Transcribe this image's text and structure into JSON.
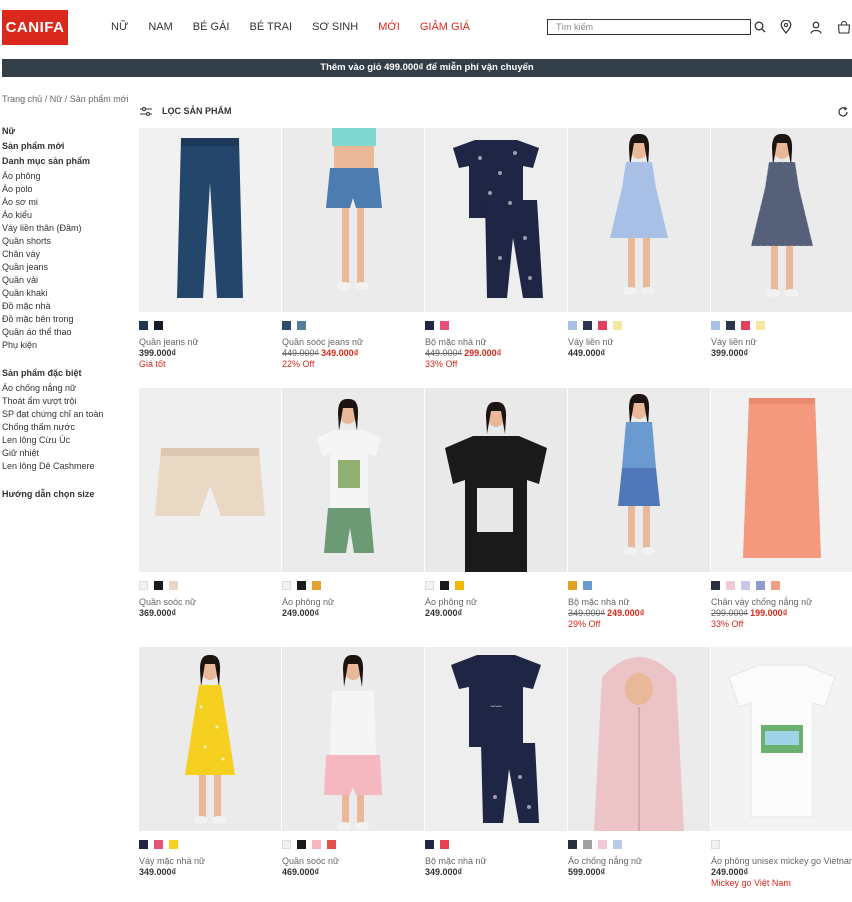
{
  "header": {
    "logo": "CANIFA",
    "nav": [
      {
        "label": "NỮ",
        "red": false
      },
      {
        "label": "NAM",
        "red": false
      },
      {
        "label": "BÉ GÁI",
        "red": false
      },
      {
        "label": "BÉ TRAI",
        "red": false
      },
      {
        "label": "SƠ SINH",
        "red": false
      },
      {
        "label": "MỚI",
        "red": true
      },
      {
        "label": "GIẢM GIÁ",
        "red": true
      }
    ],
    "search_placeholder": "Tìm kiếm"
  },
  "banner": "Thêm vào giỏ 499.000₫ để miễn phí vận chuyển",
  "breadcrumb": "Trang chủ / Nữ / Sản phẩm mới",
  "sidebar": {
    "title": "Nữ",
    "new": "Sản phẩm mới",
    "categories_title": "Danh mục sản phẩm",
    "categories": [
      "Áo phông",
      "Áo polo",
      "Áo sơ mi",
      "Áo kiểu",
      "Váy liền thân (Đầm)",
      "Quần shorts",
      "Chân váy",
      "Quần jeans",
      "Quần vải",
      "Quần khaki",
      "Đồ mặc nhà",
      "Đồ mặc bên trong",
      "Quần áo thể thao",
      "Phụ kiện"
    ],
    "special_title": "Sản phẩm đặc biệt",
    "special": [
      "Áo chống nắng nữ",
      "Thoát ẩm vượt trội",
      "SP đạt chứng chỉ an toàn",
      "Chống thấm nước",
      "Len lông Cừu Úc",
      "Giữ nhiệt",
      "Len lông Dê Cashmere"
    ],
    "guide": "Hướng dẫn chọn size"
  },
  "filter_label": "LỌC SẢN PHẨM",
  "products": [
    {
      "name": "Quần jeans nữ",
      "old": "",
      "price": "399.000₫",
      "sale": false,
      "tag": "Giá tốt",
      "swatches": [
        "#1f3552",
        "#161c26"
      ],
      "kind": "jeans",
      "bg": "#f1f1f1"
    },
    {
      "name": "Quần soóc jeans nữ",
      "old": "449.000₫",
      "price": "349.000₫",
      "sale": true,
      "tag": "22% Off",
      "swatches": [
        "#2d4d6b",
        "#4f7f99"
      ],
      "kind": "person-shorts",
      "bg": "#ebebeb"
    },
    {
      "name": "Bộ mặc nhà nữ",
      "old": "449.000₫",
      "price": "299.000₫",
      "sale": true,
      "tag": "33% Off",
      "swatches": [
        "#1f2544",
        "#e8507a"
      ],
      "kind": "pajama",
      "bg": "#eeeeee"
    },
    {
      "name": "Váy liền nữ",
      "old": "",
      "price": "449.000₫",
      "sale": false,
      "tag": "",
      "swatches": [
        "#a8c0e6",
        "#2a3550",
        "#e0405a",
        "#f5e6a0"
      ],
      "kind": "dress-blue",
      "bg": "#ebebeb"
    },
    {
      "name": "Váy liền nữ",
      "old": "",
      "price": "399.000₫",
      "sale": false,
      "tag": "",
      "swatches": [
        "#a8c0e6",
        "#2a3550",
        "#e0405a",
        "#f5e6a0"
      ],
      "kind": "dress-check",
      "bg": "#ebebeb"
    },
    {
      "name": "Quần soóc nữ",
      "old": "",
      "price": "369.000₫",
      "sale": false,
      "tag": "",
      "swatches": [
        "#f2f2f2",
        "#1a1a1a",
        "#e8d8c4"
      ],
      "kind": "shorts-beige",
      "bg": "#efefef"
    },
    {
      "name": "Áo phông nữ",
      "old": "",
      "price": "249.000₫",
      "sale": false,
      "tag": "",
      "swatches": [
        "#f2f2f2",
        "#1a1a1a",
        "#e8a030"
      ],
      "kind": "person-tee",
      "bg": "#ebebeb"
    },
    {
      "name": "Áo phông nữ",
      "old": "",
      "price": "249.000₫",
      "sale": false,
      "tag": "",
      "swatches": [
        "#f2f2f2",
        "#1a1a1a",
        "#f0b800"
      ],
      "kind": "person-black",
      "bg": "#e9e9e9"
    },
    {
      "name": "Bộ mặc nhà nữ",
      "old": "349.000₫",
      "price": "249.000₫",
      "sale": true,
      "tag": "29% Off",
      "swatches": [
        "#e0a020",
        "#6a9ad0"
      ],
      "kind": "person-floral",
      "bg": "#ebebeb"
    },
    {
      "name": "Chân váy chống nắng nữ",
      "old": "299.000₫",
      "price": "199.000₫",
      "sale": true,
      "tag": "33% Off",
      "swatches": [
        "#2a3040",
        "#f2c8d8",
        "#c8c8e8",
        "#8f9ad0",
        "#f0a080"
      ],
      "kind": "skirt",
      "bg": "#f1f1f1"
    },
    {
      "name": "Váy mặc nhà nữ",
      "old": "",
      "price": "349.000₫",
      "sale": false,
      "tag": "",
      "swatches": [
        "#1f2544",
        "#e8507a",
        "#f5d020"
      ],
      "kind": "person-yellow",
      "bg": "#ebebeb"
    },
    {
      "name": "Quần soóc nữ",
      "old": "",
      "price": "469.000₫",
      "sale": false,
      "tag": "",
      "swatches": [
        "#f2f2f2",
        "#1a1a1a",
        "#f5b8c0",
        "#e85050"
      ],
      "kind": "person-pink",
      "bg": "#ebebeb"
    },
    {
      "name": "Bộ mặc nhà nữ",
      "old": "",
      "price": "349.000₫",
      "sale": false,
      "tag": "",
      "swatches": [
        "#1f2544",
        "#e84050"
      ],
      "kind": "pajama-navy",
      "bg": "#eeeeee"
    },
    {
      "name": "Áo chống nắng nữ",
      "old": "",
      "price": "599.000₫",
      "sale": false,
      "tag": "",
      "swatches": [
        "#2a3040",
        "#a0a0a0",
        "#f2c8d8",
        "#b8cce8"
      ],
      "kind": "person-jacket",
      "bg": "#ebebeb"
    },
    {
      "name": "Áo phông unisex mickey go Vietnam",
      "old": "",
      "price": "249.000₫",
      "sale": false,
      "tag": "Mickey go Việt Nam",
      "swatches": [
        "#f2f2f2"
      ],
      "kind": "tee-white",
      "bg": "#f3f3f3"
    }
  ]
}
